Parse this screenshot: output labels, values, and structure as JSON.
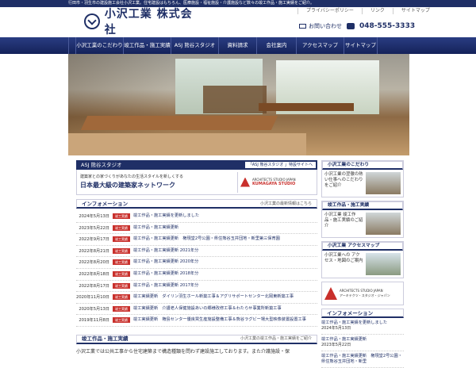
{
  "top_strip": "行田市・羽生市の建設施工会社小沢工業。住宅建設はもちろん、医療施設・福祉施設・介護施設など数々の竣工作品・施工実績をご紹介。",
  "logo": {
    "text": "小沢工業 株式会社"
  },
  "util_links": [
    "プライバシーポリシー",
    "リンク",
    "サイトマップ"
  ],
  "contact": {
    "label": "お問い合わせ",
    "phone": "048-555-3333"
  },
  "nav": [
    "小沢工業のこだわり",
    "竣工作品・施工実績",
    "ASJ 熊谷スタジオ",
    "資料請求",
    "会社案内",
    "アクセスマップ",
    "サイトマップ"
  ],
  "asj": {
    "bar_title": "ASJ 熊谷スタジオ",
    "bar_link": "「ASJ 熊谷スタジオ 」特設サイトへ",
    "copy": "建築家との家づくりがあなたの生活スタイルを新しくする",
    "headline": "日本最大級の建築家ネットワーク",
    "logo_top": "ARCHITECTS STUDIO JAPAN",
    "logo_main": "KUMAGAYA STUDIO"
  },
  "information": {
    "title": "インフォメーション",
    "link": "小沢工業の最新情報はこちら",
    "badge": "竣工実績",
    "rows": [
      {
        "date": "2024年5月13日",
        "text": "竣工作品・施工実績を更新しました"
      },
      {
        "date": "2023年5月22日",
        "text": "竣工作品・施工実績更新"
      },
      {
        "date": "2022年9月17日",
        "text": "竣工作品・施工実績更新　権現堂2号公園・県住熊谷玉井団地・新里第三保育園"
      },
      {
        "date": "2022年8月21日",
        "text": "竣工作品・施工実績更新 2021年分"
      },
      {
        "date": "2022年8月20日",
        "text": "竣工作品・施工実績更新 2020年分"
      },
      {
        "date": "2022年8月18日",
        "text": "竣工作品・施工実績更新 2018年分"
      },
      {
        "date": "2022年8月17日",
        "text": "竣工作品・施工実績更新 2017年分"
      },
      {
        "date": "2020年11月10日",
        "text": "竣工実績更新　ダイリン羽生ホール新築工事＆アグリサポートセンター北岡東新築工事"
      },
      {
        "date": "2020年5月13日",
        "text": "竣工実績更新　介護老人保健施設あいの郷様改修工事＆わたらせ事業所新築工事"
      },
      {
        "date": "2019年11月8日",
        "text": "竣工実績更新　権島センター優良買生産施設整備工事＆熊谷ラグビー場大型映像装置設置工事"
      }
    ]
  },
  "works": {
    "title": "竣工作品・施工実績",
    "link": "小沢工業の竣工作品・施工実績をご紹介",
    "intro": "小沢工業では公共工事から住宅建築まで構造種類を問わず建設施工しております。また介護施設・保"
  },
  "side": {
    "kodawari": {
      "title": "小沢工業のこだわり",
      "text": "小沢工業の翌徹の熱い仕事へのこだわりをご紹介"
    },
    "works": {
      "title": "竣工作品・施工実績",
      "text": "小沢工業 竣工作品・施工実績のご紹介"
    },
    "access": {
      "title": "小沢工業 アクセスマップ",
      "text": "小沢工業への アクセス・地図のご案内"
    },
    "asj_top": "ARCHITECTS STUDIO JAPAN",
    "asj_bottom": "アーキテクツ・スタジオ・ジャパン",
    "info_title": "インフォメーション",
    "info_items": [
      {
        "text": "竣工作品・施工実績を更新しました",
        "date": "2024年5月13日"
      },
      {
        "text": "竣工作品・施工実績更新",
        "date": "2023年5月22日"
      },
      {
        "text": "竣工作品・施工実績更新　権現堂2号公園・県住熊谷玉井団地・新里",
        "date": ""
      }
    ]
  }
}
